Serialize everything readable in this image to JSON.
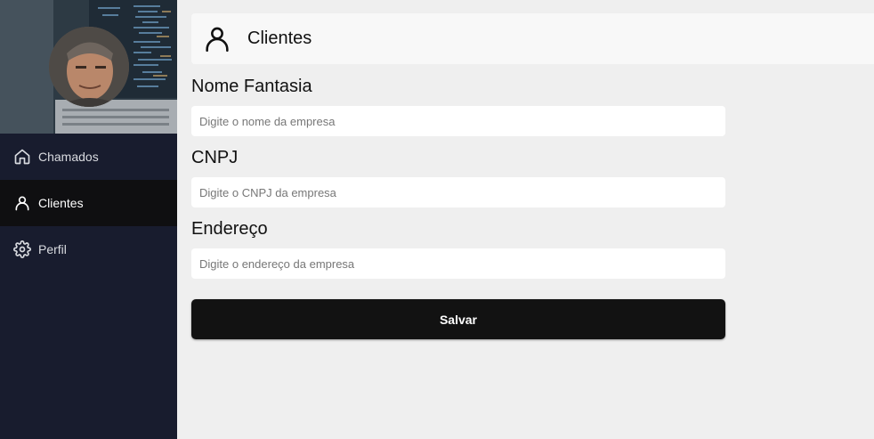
{
  "sidebar": {
    "items": [
      {
        "label": "Chamados",
        "icon": "home-icon",
        "active": false
      },
      {
        "label": "Clientes",
        "icon": "user-icon",
        "active": true
      },
      {
        "label": "Perfil",
        "icon": "gear-icon",
        "active": false
      }
    ]
  },
  "header": {
    "title": "Clientes",
    "icon": "user-icon"
  },
  "form": {
    "name_label": "Nome Fantasia",
    "name_placeholder": "Digite o nome da empresa",
    "cnpj_label": "CNPJ",
    "cnpj_placeholder": "Digite o CNPJ da empresa",
    "address_label": "Endereço",
    "address_placeholder": "Digite o endereço da empresa",
    "save_label": "Salvar"
  },
  "colors": {
    "sidebar_bg": "#181c2e",
    "active_item_bg": "#0f0f11",
    "page_bg": "#efefef",
    "button_bg": "#121212"
  }
}
